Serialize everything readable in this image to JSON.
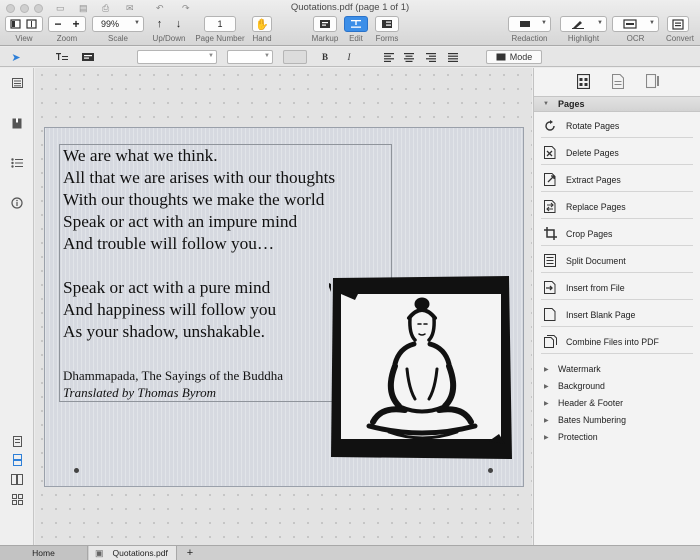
{
  "window": {
    "title": "Quotations.pdf (page 1 of 1)"
  },
  "toolbar": {
    "zoom_value": "99%",
    "page_number": "1",
    "labels": {
      "view": "View",
      "zoom": "Zoom",
      "scale": "Scale",
      "updown": "Up/Down",
      "page_number": "Page Number",
      "hand": "Hand",
      "markup": "Markup",
      "edit": "Edit",
      "forms": "Forms",
      "redaction": "Redaction",
      "highlight": "Highlight",
      "ocr": "OCR",
      "convert": "Convert"
    },
    "zoom_out": "−",
    "zoom_in": "+",
    "scroll_up": "↑",
    "scroll_down": "↓"
  },
  "formatbar": {
    "bold": "B",
    "italic": "I",
    "mode_label": "Mode"
  },
  "document": {
    "quote_lines": [
      "We are what we think.",
      "All that we are arises with our thoughts",
      "With our thoughts we make the world",
      "Speak or act with an impure mind",
      "And trouble will follow you…",
      "Speak or act with a pure mind",
      "And happiness will follow you",
      "As your shadow, unshakable."
    ],
    "citation": "Dhammapada, The Sayings of the Buddha",
    "translator": "Translated by Thomas Byrom"
  },
  "right_panel": {
    "pages_header": "Pages",
    "page_items": [
      {
        "label": "Rotate Pages",
        "icon": "rotate-icon"
      },
      {
        "label": "Delete Pages",
        "icon": "delete-page-icon"
      },
      {
        "label": "Extract Pages",
        "icon": "extract-page-icon"
      },
      {
        "label": "Replace Pages",
        "icon": "replace-page-icon"
      },
      {
        "label": "Crop Pages",
        "icon": "crop-icon"
      },
      {
        "label": "Split Document",
        "icon": "split-icon"
      },
      {
        "label": "Insert from File",
        "icon": "insert-file-icon"
      },
      {
        "label": "Insert Blank Page",
        "icon": "blank-page-icon"
      },
      {
        "label": "Combine Files into PDF",
        "icon": "combine-icon"
      }
    ],
    "sections": [
      "Watermark",
      "Background",
      "Header & Footer",
      "Bates Numbering",
      "Protection"
    ]
  },
  "tabs": {
    "home": "Home",
    "file": "Quotations.pdf",
    "add": "+"
  },
  "colors": {
    "accent": "#3b8ee8",
    "page_bg": "#d6d9e0"
  }
}
